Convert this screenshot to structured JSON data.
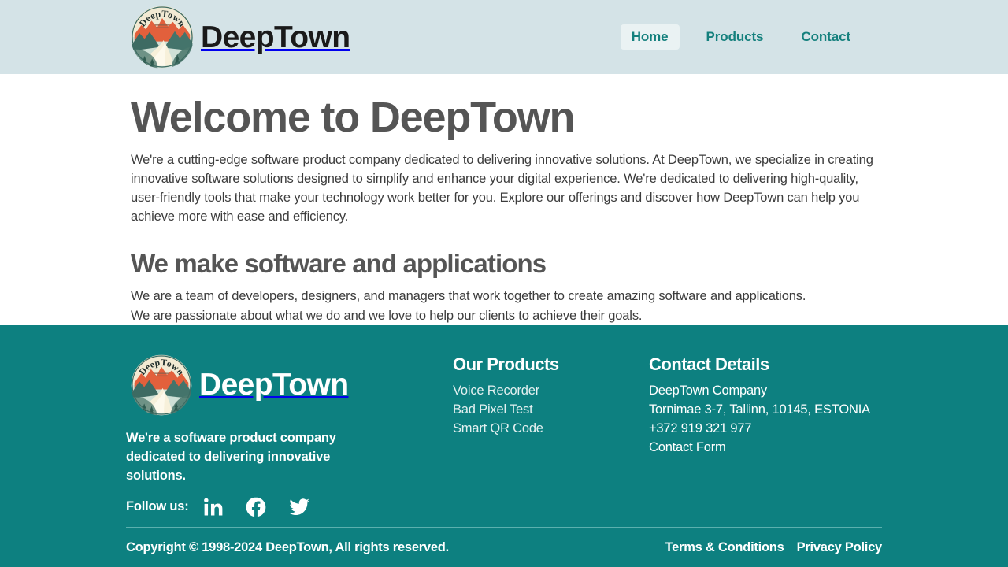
{
  "header": {
    "logo_alt": "DeepTown circular mountain and river badge logo",
    "brand_name": "DeepTown",
    "nav": [
      {
        "label": "Home",
        "active": true
      },
      {
        "label": "Products",
        "active": false
      },
      {
        "label": "Contact",
        "active": false
      }
    ]
  },
  "main": {
    "hero_title": "Welcome to DeepTown",
    "hero_paragraph": "We're a cutting-edge software product company dedicated to delivering innovative solutions. At DeepTown, we specialize in creating innovative software solutions designed to simplify and enhance your digital experience. We're dedicated to delivering high-quality, user-friendly tools that make your technology work better for you. Explore our offerings and discover how DeepTown can help you achieve more with ease and efficiency.",
    "section_title": "We make software and applications",
    "section_paragraph": "We are a team of developers, designers, and managers that work together to create amazing software and applications. We are passionate about what we do and we love to help our clients to achieve their goals."
  },
  "footer": {
    "brand_name": "DeepTown",
    "tagline": "We're a software product company dedicated to delivering innovative solutions.",
    "follow_label": "Follow us:",
    "social": [
      {
        "name": "linkedin",
        "label": "LinkedIn"
      },
      {
        "name": "facebook",
        "label": "Facebook"
      },
      {
        "name": "twitter",
        "label": "Twitter"
      }
    ],
    "products": {
      "heading": "Our Products",
      "items": [
        {
          "label": "Voice Recorder"
        },
        {
          "label": "Bad Pixel Test"
        },
        {
          "label": "Smart QR Code"
        }
      ]
    },
    "contact": {
      "heading": "Contact Details",
      "items": [
        {
          "label": "DeepTown Company",
          "link": false
        },
        {
          "label": "Tornimae 3-7, Tallinn, 10145, ESTONIA",
          "link": false
        },
        {
          "label": "+372 919 321 977",
          "link": true
        },
        {
          "label": "Contact Form",
          "link": true
        }
      ]
    },
    "copyright": "Copyright © 1998-2024 DeepTown, All rights reserved.",
    "legal": [
      {
        "label": "Terms & Conditions"
      },
      {
        "label": "Privacy Policy"
      }
    ]
  },
  "colors": {
    "header_bg": "#d4e3e7",
    "footer_bg": "#0d8080",
    "nav_link": "#14807d",
    "nav_active_bg": "#eaf2f3",
    "heading": "#555555",
    "body_text": "#3c3c3c",
    "logo_mountain": "#e2603c",
    "logo_hill": "#3d6b63",
    "logo_cream": "#f2ead3",
    "logo_water": "#a9cfc6"
  }
}
